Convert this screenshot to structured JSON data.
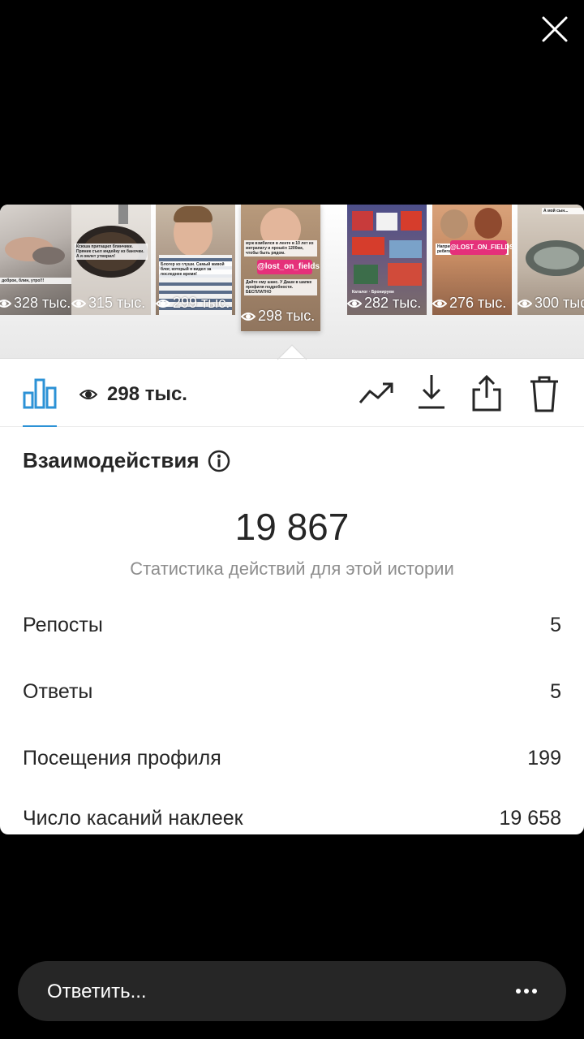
{
  "story_views": [
    {
      "count": "328 тыс.",
      "caption": "доброе, блин, утро!!!"
    },
    {
      "count": "315 тыс.",
      "caption": "Ксюша притащил блинчики. Пряник съел индейку из баночки. А я омлет утворил!"
    },
    {
      "count": "299 тыс.",
      "caption": "Блогер из глуши. Самый живой блог, который я видел за последнее время!"
    },
    {
      "count": "298 тыс.",
      "caption": "муж взмбился в ленте в 10 лет из метрапату и прошёл 1200км, чтобы быть рядом.",
      "tag": "@lost_on_fields",
      "caption2": "Дайте ему шанс. У Даши в шапке профиля подробности. БЕСПЛАТНО"
    },
    {
      "count": "282 тыс.",
      "caption": "Каталог · Бронируем"
    },
    {
      "count": "276 тыс.",
      "caption": "Например, под их вниманием ребята",
      "tag": "@LOST_ON_FIELDS"
    },
    {
      "count": "300 тыс.",
      "caption": "А мой сын..."
    }
  ],
  "toolbar": {
    "reach_count": "298 тыс.",
    "icons": [
      "bar-chart-icon",
      "eye-icon",
      "trend-icon",
      "download-icon",
      "share-icon",
      "trash-icon",
      "close-icon",
      "info-icon",
      "more-icon"
    ]
  },
  "interactions": {
    "title": "Взаимодействия",
    "total": "19 867",
    "subtitle": "Статистика действий для этой истории",
    "rows": [
      {
        "label": "Репосты",
        "value": "5"
      },
      {
        "label": "Ответы",
        "value": "5"
      },
      {
        "label": "Посещения профиля",
        "value": "199"
      },
      {
        "label": "Число касаний наклеек",
        "value": "19 658"
      }
    ]
  },
  "reply": {
    "placeholder": "Ответить..."
  },
  "colors": {
    "accent": "#2c92d6",
    "tag_pink": "#e5307a",
    "text": "#262626",
    "muted": "#8e8e8e"
  }
}
